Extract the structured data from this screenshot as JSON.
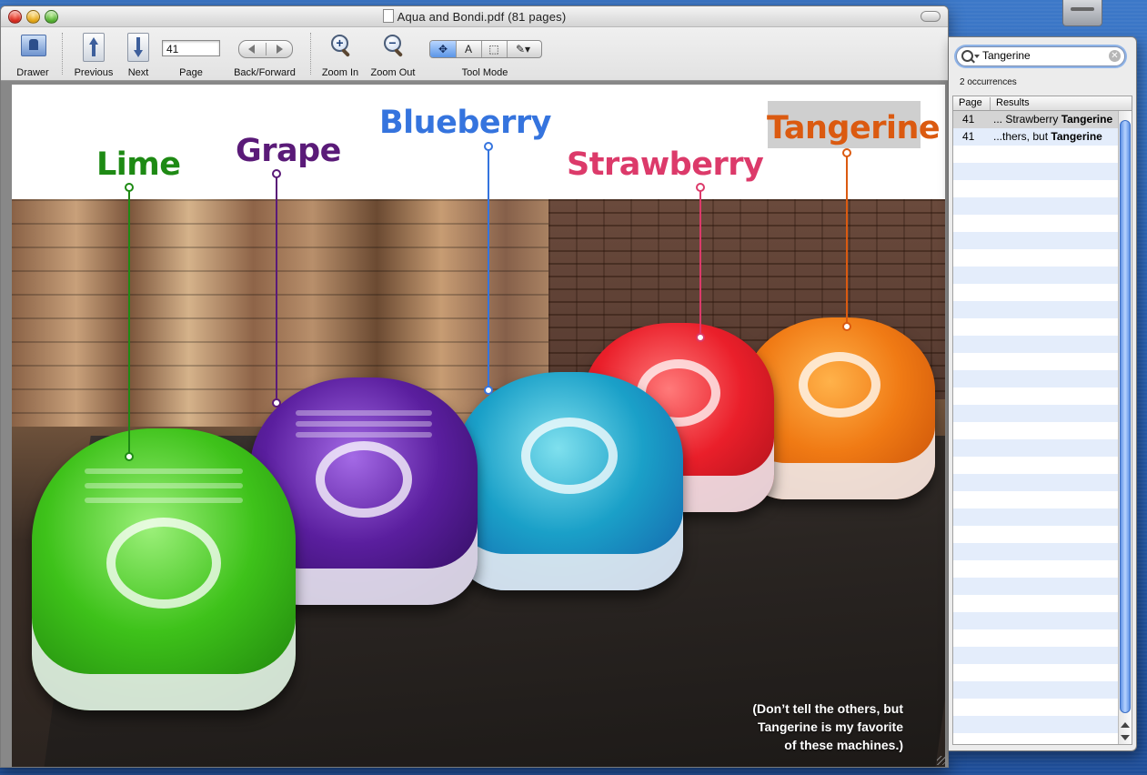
{
  "window": {
    "title": "Aqua and Bondi.pdf (81 pages)"
  },
  "toolbar": {
    "drawer_label": "Drawer",
    "previous_label": "Previous",
    "next_label": "Next",
    "page_label": "Page",
    "page_value": "41",
    "back_forward_label": "Back/Forward",
    "zoom_in_label": "Zoom In",
    "zoom_out_label": "Zoom Out",
    "tool_mode_label": "Tool Mode",
    "tool_modes": [
      "move",
      "text",
      "select",
      "annotate"
    ],
    "tool_mode_selected": "move",
    "text_tool_glyph": "A"
  },
  "page": {
    "labels": {
      "lime": "Lime",
      "grape": "Grape",
      "blueberry": "Blueberry",
      "strawberry": "Strawberry",
      "tangerine": "Tangerine"
    },
    "label_colors": {
      "lime": "#1e8a14",
      "grape": "#5a1a78",
      "blueberry": "#3574de",
      "strawberry": "#dc3a6a",
      "tangerine": "#db5a10"
    },
    "caption_line1": "(Don’t tell the others, but",
    "caption_line2": "Tangerine is my favorite",
    "caption_line3": "of these machines.)"
  },
  "search": {
    "query": "Tangerine",
    "occurrences": "2 occurrences",
    "col_page": "Page",
    "col_results": "Results",
    "results": [
      {
        "page": "41",
        "before": "... Strawberry ",
        "match": "Tangerine"
      },
      {
        "page": "41",
        "before": "...thers, but  ",
        "match": "Tangerine"
      }
    ]
  }
}
